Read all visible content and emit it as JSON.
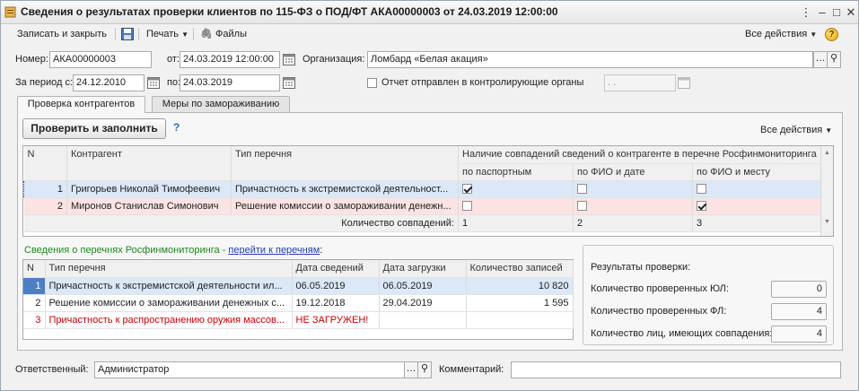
{
  "window": {
    "title": "Сведения о результатах проверки клиентов по 115-ФЗ о ПОД/ФТ АКА00000003 от 24.03.2019 12:00:00"
  },
  "toolbar": {
    "save_close": "Записать и закрыть",
    "print": "Печать",
    "files": "Файлы",
    "all_actions": "Все действия",
    "help": "?"
  },
  "form": {
    "number_label": "Номер:",
    "number_value": "АКА00000003",
    "from_label": "от:",
    "from_value": "24.03.2019 12:00:00",
    "org_label": "Организация:",
    "org_value": "Ломбард «Белая акация»",
    "period_label": "За период с:",
    "period_from": "24.12.2010",
    "to_label": "по:",
    "period_to": "24.03.2019",
    "report_sent_label": "Отчет отправлен в контролирующие органы",
    "report_sent_checked": false,
    "report_sent_date": " .  .    "
  },
  "tabs": [
    {
      "label": "Проверка контрагентов",
      "active": true
    },
    {
      "label": "Меры по замораживанию",
      "active": false
    }
  ],
  "check_panel": {
    "fill_button": "Проверить и заполнить",
    "help_mark": "?",
    "all_actions": "Все действия"
  },
  "counterparty_table": {
    "headers": {
      "n": "N",
      "counterparty": "Контрагент",
      "list_type": "Тип перечня",
      "matches_group": "Наличие совпадений сведений о контрагенте в перечне Росфинмониторинга",
      "by_passport": "по паспортным",
      "by_name_date": "по ФИО и дате",
      "by_name_place": "по ФИО и месту"
    },
    "rows": [
      {
        "n": "1",
        "counterparty": "Григорьев Николай Тимофеевич",
        "list_type": "Причастность к экстремистской деятельност...",
        "passport": true,
        "name_date": false,
        "name_place": false
      },
      {
        "n": "2",
        "counterparty": "Миронов Станислав Симонович",
        "list_type": "Решение комиссии о замораживании денежн...",
        "passport": false,
        "name_date": false,
        "name_place": true
      }
    ],
    "footer": {
      "label": "Количество совпадений:",
      "passport": "1",
      "name_date": "2",
      "name_place": "3"
    }
  },
  "lists_info": {
    "prefix": "Сведения о перечнях Росфинмониторинга - ",
    "link": "перейти к перечням",
    "suffix": ":"
  },
  "lists_table": {
    "headers": {
      "n": "N",
      "list_type": "Тип перечня",
      "info_date": "Дата сведений",
      "load_date": "Дата загрузки",
      "records": "Количество записей"
    },
    "rows": [
      {
        "n": "1",
        "list_type": "Причастность к экстремистской деятельности ил...",
        "info_date": "06.05.2019",
        "load_date": "06.05.2019",
        "records": "10 820"
      },
      {
        "n": "2",
        "list_type": "Решение комиссии о замораживании денежных с...",
        "info_date": "19.12.2018",
        "load_date": "29.04.2019",
        "records": "1 595"
      },
      {
        "n": "3",
        "list_type": "Причастность к распространению оружия массов...",
        "info_date": "НЕ ЗАГРУЖЕН!",
        "load_date": "",
        "records": ""
      }
    ]
  },
  "results": {
    "title": "Результаты проверки:",
    "checked_legal_label": "Количество проверенных ЮЛ:",
    "checked_legal_value": "0",
    "checked_individual_label": "Количество проверенных ФЛ:",
    "checked_individual_value": "4",
    "matched_label": "Количество лиц, имеющих совпадения:",
    "matched_value": "4"
  },
  "bottom": {
    "responsible_label": "Ответственный:",
    "responsible_value": "Администратор",
    "comment_label": "Комментарий:",
    "comment_value": ""
  },
  "colors": {
    "selected_row": "#dbe8f7",
    "highlight_row": "#fbe3e3",
    "error_text": "#d00000",
    "link": "#1f3fb3"
  }
}
